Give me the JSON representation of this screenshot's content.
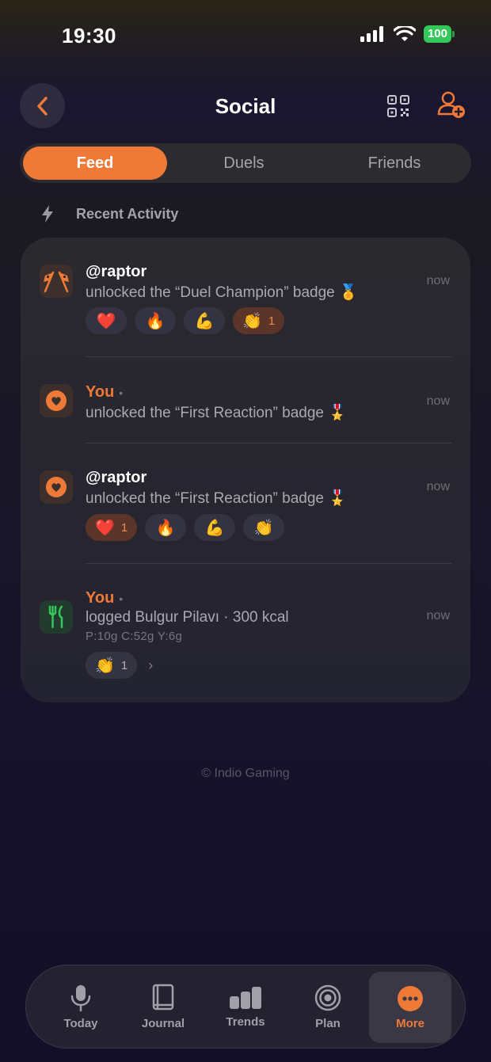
{
  "status": {
    "time": "19:30",
    "battery": "100"
  },
  "nav": {
    "title": "Social"
  },
  "tabs": [
    {
      "label": "Feed",
      "active": true
    },
    {
      "label": "Duels",
      "active": false
    },
    {
      "label": "Friends",
      "active": false
    }
  ],
  "section": {
    "title": "Recent Activity"
  },
  "feed": [
    {
      "icon": "checkered-flags-icon",
      "user": "@raptor",
      "desc": "unlocked the “Duel Champion” badge 🏅",
      "time": "now",
      "reactions": [
        {
          "emoji": "❤️",
          "count": ""
        },
        {
          "emoji": "🔥",
          "count": ""
        },
        {
          "emoji": "💪",
          "count": ""
        },
        {
          "emoji": "👏",
          "count": "1"
        }
      ]
    },
    {
      "icon": "heart-badge-icon",
      "user": "You",
      "desc": "unlocked the “First Reaction” badge 🎖️",
      "time": "now"
    },
    {
      "icon": "heart-badge-icon",
      "user": "@raptor",
      "desc": "unlocked the “First Reaction” badge 🎖️",
      "time": "now",
      "reactions": [
        {
          "emoji": "❤️",
          "count": "1"
        },
        {
          "emoji": "🔥",
          "count": ""
        },
        {
          "emoji": "💪",
          "count": ""
        },
        {
          "emoji": "👏",
          "count": ""
        }
      ]
    },
    {
      "icon": "fork-knife-icon",
      "user": "You",
      "desc": "logged Bulgur Pilavı · 300 kcal",
      "macros": "P:10g  C:52g  Y:6g",
      "time": "now",
      "reactions": [
        {
          "emoji": "👏",
          "count": "1"
        }
      ]
    }
  ],
  "footer": {
    "copyright": "© Indio Gaming"
  },
  "tabbar": [
    {
      "label": "Today",
      "icon": "microphone-icon"
    },
    {
      "label": "Journal",
      "icon": "book-icon"
    },
    {
      "label": "Trends",
      "icon": "bar-chart-icon"
    },
    {
      "label": "Plan",
      "icon": "target-icon"
    },
    {
      "label": "More",
      "icon": "more-dots-icon",
      "active": true
    }
  ],
  "colors": {
    "accent": "#ef7a38",
    "green": "#34c759"
  }
}
